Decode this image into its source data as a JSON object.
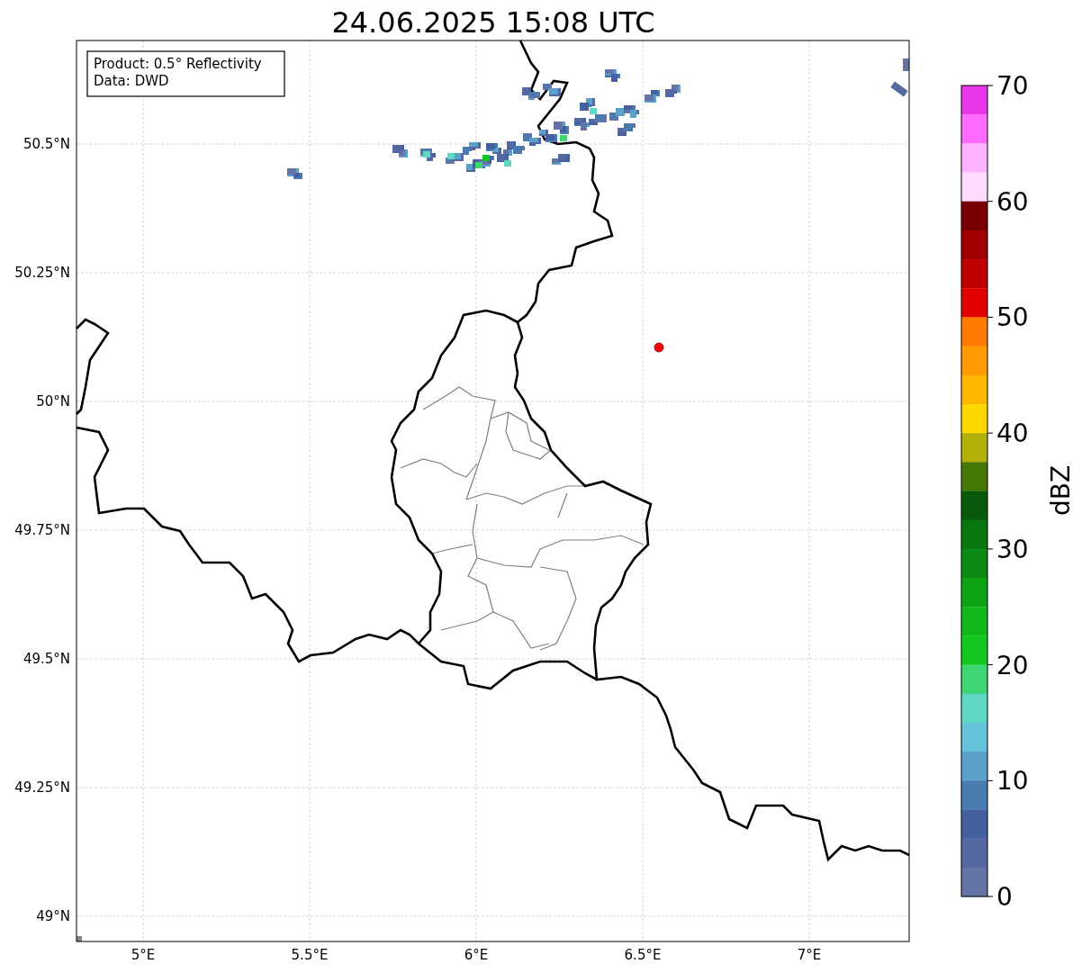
{
  "title": "24.06.2025 15:08 UTC",
  "info_box": [
    "Product: 0.5° Reflectivity",
    "Data: DWD"
  ],
  "lat_labels": [
    "50.5°N",
    "50.25°N",
    "50°N",
    "49.75°N",
    "49.5°N",
    "49.25°N",
    "49°N"
  ],
  "lon_labels": [
    "5°E",
    "5.5°E",
    "6°E",
    "6.5°E",
    "7°E"
  ],
  "colorbar": {
    "label": "dBZ",
    "ticks": [
      "70",
      "60",
      "50",
      "40",
      "30",
      "20",
      "10",
      "0"
    ],
    "segments": [
      {
        "color": "#ea36ea"
      },
      {
        "color": "#ff6aff"
      },
      {
        "color": "#ffb2ff"
      },
      {
        "color": "#ffdcff"
      },
      {
        "color": "#780000"
      },
      {
        "color": "#a00000"
      },
      {
        "color": "#c00000"
      },
      {
        "color": "#e30000"
      },
      {
        "color": "#ff7a00"
      },
      {
        "color": "#ff9a00"
      },
      {
        "color": "#ffb700"
      },
      {
        "color": "#ffd700"
      },
      {
        "color": "#b0b008"
      },
      {
        "color": "#467808"
      },
      {
        "color": "#075a0b"
      },
      {
        "color": "#0a760f"
      },
      {
        "color": "#0a8a12"
      },
      {
        "color": "#0ea314"
      },
      {
        "color": "#10b81a"
      },
      {
        "color": "#12c81e"
      },
      {
        "color": "#3dd672"
      },
      {
        "color": "#5fd8c6"
      },
      {
        "color": "#66c3dc"
      },
      {
        "color": "#5aa0c8"
      },
      {
        "color": "#4a7bb0"
      },
      {
        "color": "#4560a0"
      },
      {
        "color": "#5668a0"
      },
      {
        "color": "#6574a6"
      }
    ]
  }
}
